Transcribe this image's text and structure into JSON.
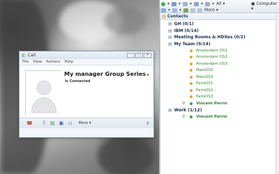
{
  "call_window": {
    "title": "Call",
    "menu": [
      "File",
      "View",
      "Actions",
      "Help"
    ],
    "contact_name": "My manager Group Series",
    "status": "Is Connected",
    "toolbar": {
      "more_label": "More"
    },
    "icons": [
      "hangup-icon",
      "dialpad-icon",
      "chat-icon",
      "screen-share-icon",
      "speaker-icon"
    ]
  },
  "sidebar": {
    "toolbar": {
      "all_label": "All",
      "computer_label": "Computer",
      "more_label": "More"
    },
    "contacts_header": "Contacts",
    "groups": [
      {
        "label": "GH (0/1)",
        "members": []
      },
      {
        "label": "IBM (0/14)",
        "members": []
      },
      {
        "label": "Meeting Rooms & HDXes (0/2)",
        "members": []
      },
      {
        "label": "My Team (9/14)",
        "members": [
          {
            "name": "Amsterdam OS1",
            "status": "away"
          },
          {
            "name": "Amsterdam OS2",
            "status": "away"
          },
          {
            "name": "Amsterdam OS3",
            "status": "away"
          },
          {
            "name": "MainOS2",
            "status": "away"
          },
          {
            "name": "MainOS3",
            "status": "away"
          },
          {
            "name": "ParisOS1",
            "status": "away"
          },
          {
            "name": "ParisOS2",
            "status": "away"
          },
          {
            "name": "ParisOS3",
            "status": "away"
          },
          {
            "name": "Vincent Perrin",
            "status": "online"
          }
        ]
      },
      {
        "label": "Work (1/12)",
        "members": [
          {
            "name": "Vincent Perrin",
            "status": "online"
          }
        ]
      }
    ]
  },
  "colors": {
    "accent": "#1e3a5f",
    "online": "#3aa13a",
    "away": "#e2a52a",
    "contact_text": "#2e8a2e"
  }
}
